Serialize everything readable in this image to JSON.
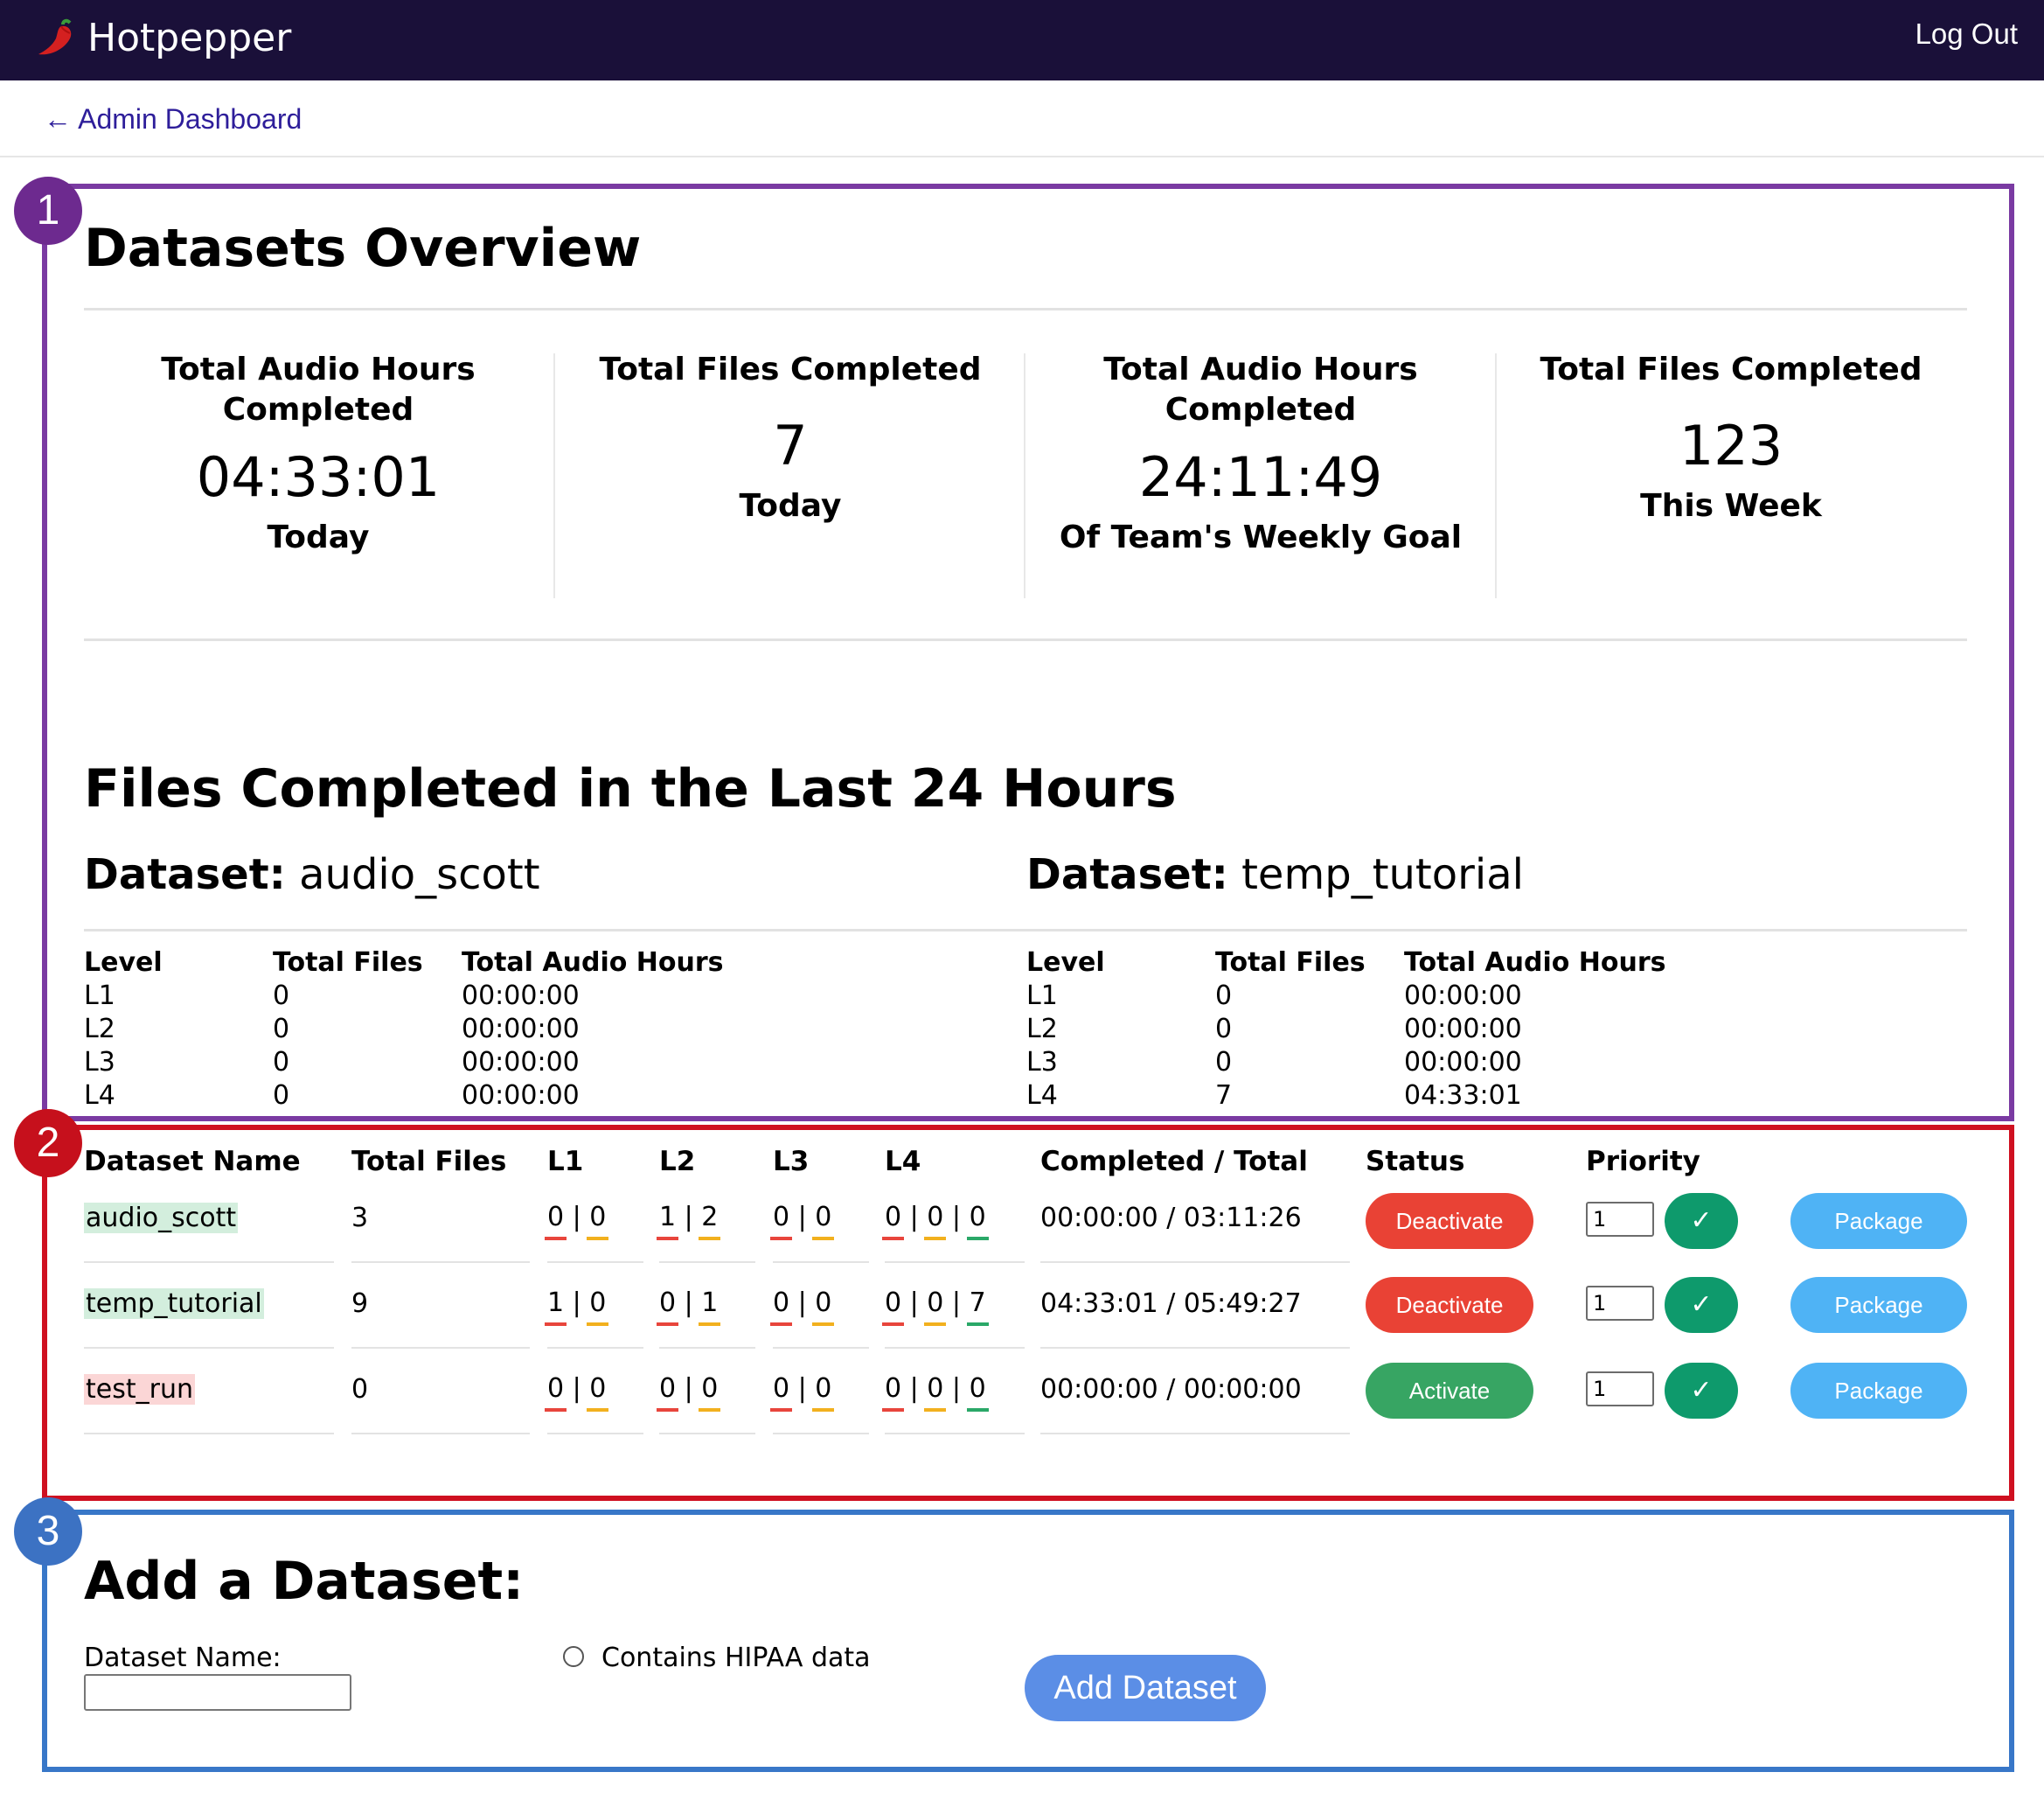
{
  "nav": {
    "brand": "Hotpepper",
    "logout": "Log Out",
    "back_link": "← Admin Dashboard"
  },
  "badges": [
    "1",
    "2",
    "3"
  ],
  "overview": {
    "title": "Datasets Overview",
    "stats": [
      {
        "label": "Total Audio Hours Completed",
        "value": "04:33:01",
        "sub": "Today"
      },
      {
        "label": "Total Files Completed",
        "value": "7",
        "sub": "Today"
      },
      {
        "label": "Total Audio Hours Completed",
        "value": "24:11:49",
        "sub": "Of Team's Weekly Goal"
      },
      {
        "label": "Total Files Completed",
        "value": "123",
        "sub": "This Week"
      }
    ]
  },
  "last24": {
    "title": "Files Completed in the Last 24 Hours",
    "dataset_prefix": "Dataset:",
    "columns": [
      "Level",
      "Total Files",
      "Total Audio Hours"
    ],
    "datasets": [
      {
        "name": "audio_scott",
        "rows": [
          [
            "L1",
            "0",
            "00:00:00"
          ],
          [
            "L2",
            "0",
            "00:00:00"
          ],
          [
            "L3",
            "0",
            "00:00:00"
          ],
          [
            "L4",
            "0",
            "00:00:00"
          ]
        ]
      },
      {
        "name": "temp_tutorial",
        "rows": [
          [
            "L1",
            "0",
            "00:00:00"
          ],
          [
            "L2",
            "0",
            "00:00:00"
          ],
          [
            "L3",
            "0",
            "00:00:00"
          ],
          [
            "L4",
            "7",
            "04:33:01"
          ]
        ]
      }
    ]
  },
  "datasets_table": {
    "headers": [
      "Dataset Name",
      "Total Files",
      "L1",
      "L2",
      "L3",
      "L4",
      "Completed / Total",
      "Status",
      "Priority"
    ],
    "rows": [
      {
        "name": "audio_scott",
        "name_color": "#d3eedd",
        "total_files": "3",
        "l1": [
          "0",
          "0"
        ],
        "l2": [
          "1",
          "2"
        ],
        "l3": [
          "0",
          "0"
        ],
        "l4": [
          "0",
          "0",
          "0"
        ],
        "completed_total": "00:00:00 / 03:11:26",
        "status_button": "Deactivate",
        "priority": "1",
        "confirm": "✓",
        "package": "Package"
      },
      {
        "name": "temp_tutorial",
        "name_color": "#d3eedd",
        "total_files": "9",
        "l1": [
          "1",
          "0"
        ],
        "l2": [
          "0",
          "1"
        ],
        "l3": [
          "0",
          "0"
        ],
        "l4": [
          "0",
          "0",
          "7"
        ],
        "completed_total": "04:33:01  / 05:49:27",
        "status_button": "Deactivate",
        "priority": "1",
        "confirm": "✓",
        "package": "Package"
      },
      {
        "name": "test_run",
        "name_color": "#fbd6d6",
        "total_files": "0",
        "l1": [
          "0",
          "0"
        ],
        "l2": [
          "0",
          "0"
        ],
        "l3": [
          "0",
          "0"
        ],
        "l4": [
          "0",
          "0",
          "0"
        ],
        "completed_total": "00:00:00 / 00:00:00",
        "status_button": "Activate",
        "priority": "1",
        "confirm": "✓",
        "package": "Package"
      }
    ]
  },
  "add_dataset": {
    "title": "Add a Dataset:",
    "name_label": "Dataset Name:",
    "name_value": "",
    "hipaa_label": "Contains HIPAA data",
    "hipaa_checked": false,
    "submit": "Add Dataset"
  },
  "colors": {
    "navbar": "#1a1039",
    "section1": "#7a3aa2",
    "section2": "#cf1020",
    "section3": "#3877c8",
    "deactivate": "#e94235",
    "activate": "#37a563",
    "package": "#4fb3f5",
    "confirm": "#0e9a6c",
    "level_underline_1": "#e8453c",
    "level_underline_2": "#f2b01e",
    "level_underline_3": "#2aa868"
  },
  "icons": {
    "brand": "chili-pepper-icon",
    "confirm": "checkmark-icon",
    "radio": "radio-button-icon"
  }
}
